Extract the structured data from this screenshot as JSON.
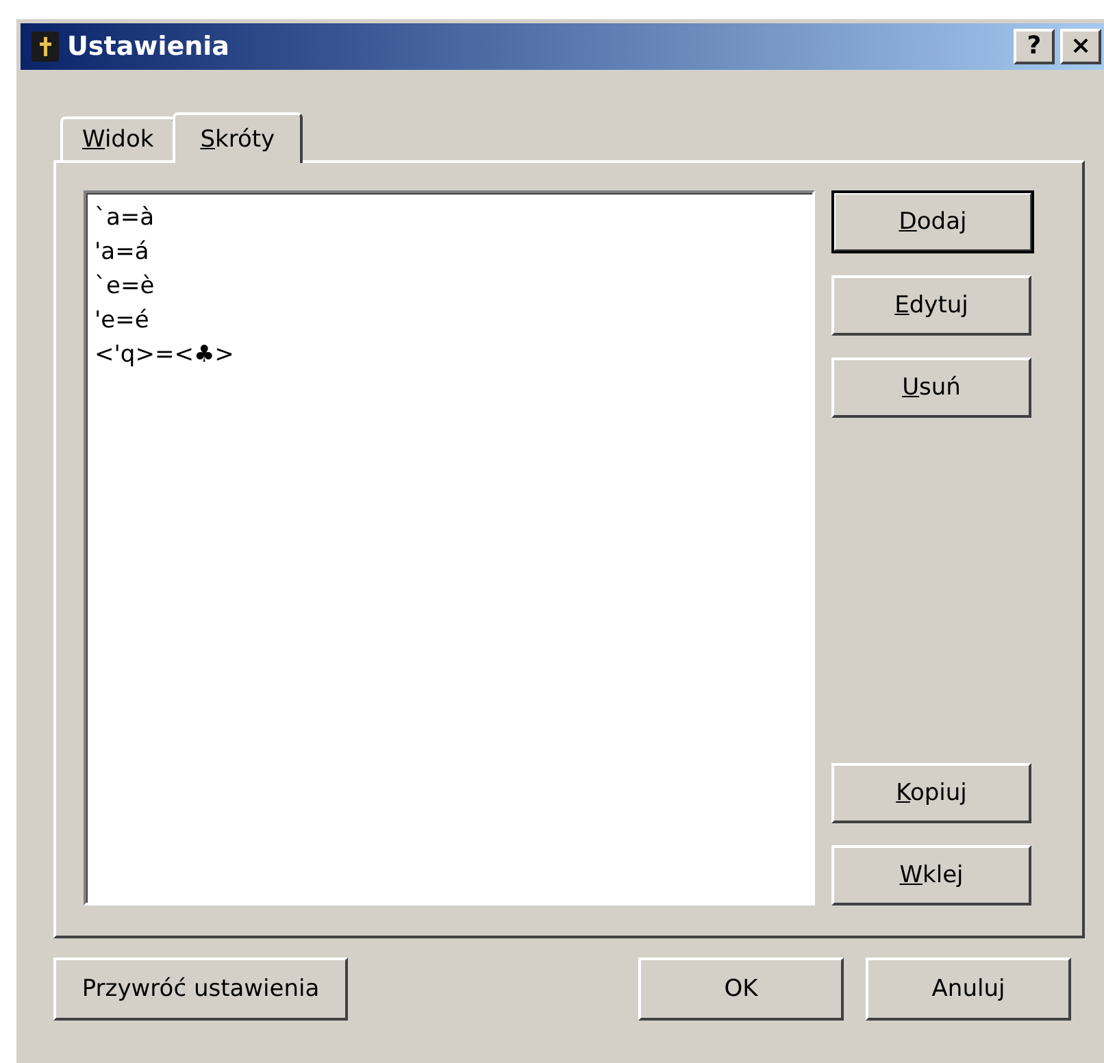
{
  "window": {
    "title": "Ustawienia",
    "help_button": "?",
    "close_button": "×"
  },
  "tabs": [
    {
      "accel": "W",
      "rest": "idok",
      "selected": false
    },
    {
      "accel": "S",
      "rest": "króty",
      "selected": true
    }
  ],
  "shortcuts": [
    "`a=à",
    "'a=á",
    "`e=è",
    "'e=é",
    "<'q>=<♣>"
  ],
  "side_buttons_top": [
    {
      "accel": "D",
      "rest": "odaj",
      "default": true
    },
    {
      "accel": "E",
      "rest": "dytuj",
      "default": false
    },
    {
      "accel": "U",
      "rest": "suń",
      "default": false
    }
  ],
  "side_buttons_bottom": [
    {
      "accel": "K",
      "rest": "opiuj",
      "default": false
    },
    {
      "accel": "W",
      "rest": "klej",
      "default": false
    }
  ],
  "footer_left": [
    "Przywróć ustawienia"
  ],
  "footer_right": [
    "OK",
    "Anuluj"
  ]
}
